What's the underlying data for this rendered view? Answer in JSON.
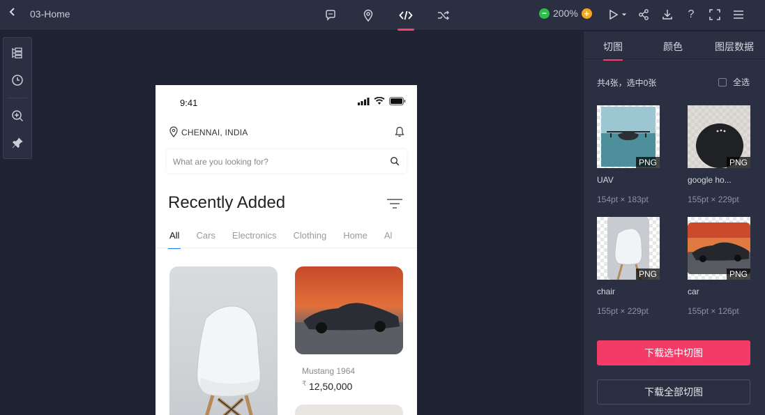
{
  "topbar": {
    "back_icon": "chevron-left-icon",
    "page_name": "03-Home",
    "tools": [
      "comment-icon",
      "location-pin-icon",
      "code-icon",
      "shuffle-icon"
    ],
    "active_tool": "code-icon",
    "zoom_level": "200%",
    "right_icons": [
      "play-icon",
      "share-icon",
      "download-icon",
      "help-icon",
      "fullscreen-icon",
      "menu-icon"
    ],
    "accent_color": "#ff3d6e"
  },
  "left_tools": [
    "layers-icon",
    "history-icon",
    "zoom-in-icon",
    "pin-icon"
  ],
  "phone": {
    "time": "9:41",
    "location": "CHENNAI, INDIA",
    "search_placeholder": "What are you looking for?",
    "section_title": "Recently Added",
    "tabs": [
      "All",
      "Cars",
      "Electronics",
      "Clothing",
      "Home",
      "Al"
    ],
    "active_tab": "All",
    "tab_accent": "#1f7bf3",
    "product": {
      "name": "Mustang 1964",
      "currency": "₹",
      "price": "12,50,000"
    }
  },
  "panel": {
    "tabs": [
      "切图",
      "颜色",
      "图层数据"
    ],
    "active_tab": "切图",
    "count_text": "共4张，选中0张",
    "select_all": "全选",
    "assets": [
      {
        "name": "UAV",
        "size": "154pt × 183pt",
        "format": "PNG"
      },
      {
        "name": "google ho...",
        "size": "155pt × 229pt",
        "format": "PNG"
      },
      {
        "name": "chair",
        "size": "155pt × 229pt",
        "format": "PNG"
      },
      {
        "name": "car",
        "size": "155pt × 126pt",
        "format": "PNG"
      }
    ],
    "download_selected": "下载选中切图",
    "download_all": "下载全部切图",
    "primary_color": "#f43b68"
  }
}
